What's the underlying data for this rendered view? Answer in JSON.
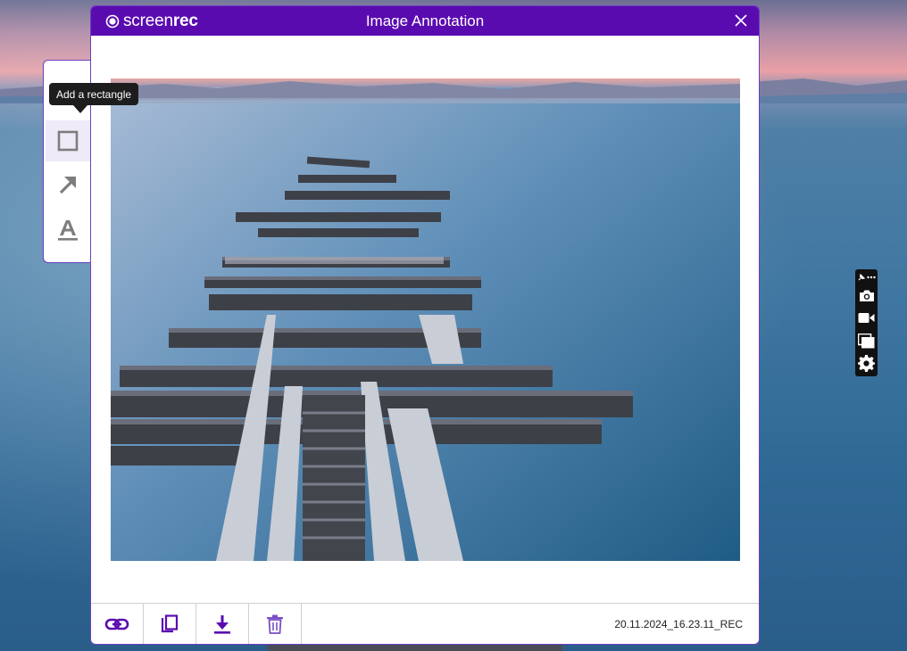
{
  "dialog": {
    "brand": {
      "prefix": "screen",
      "suffix": "rec"
    },
    "title": "Image Annotation"
  },
  "tools": {
    "tooltip": "Add a rectangle",
    "items": [
      {
        "name": "rectangle",
        "icon": "rectangle-icon"
      },
      {
        "name": "arrow",
        "icon": "arrow-icon"
      },
      {
        "name": "text",
        "icon": "text-icon"
      }
    ]
  },
  "footer": {
    "buttons": [
      {
        "name": "copy-link",
        "icon": "link-icon"
      },
      {
        "name": "copy",
        "icon": "copy-icon"
      },
      {
        "name": "download",
        "icon": "download-icon"
      },
      {
        "name": "delete",
        "icon": "trash-icon"
      }
    ],
    "filename": "20.11.2024_16.23.11_REC"
  },
  "recorder_toolbar": {
    "items": [
      "pin-icon",
      "more-icon",
      "camera-icon",
      "video-icon",
      "windows-icon",
      "gear-icon"
    ]
  },
  "colors": {
    "accent": "#5a0bb0",
    "footer_icon": "#5a0bb0",
    "tool_icon": "#808080"
  }
}
